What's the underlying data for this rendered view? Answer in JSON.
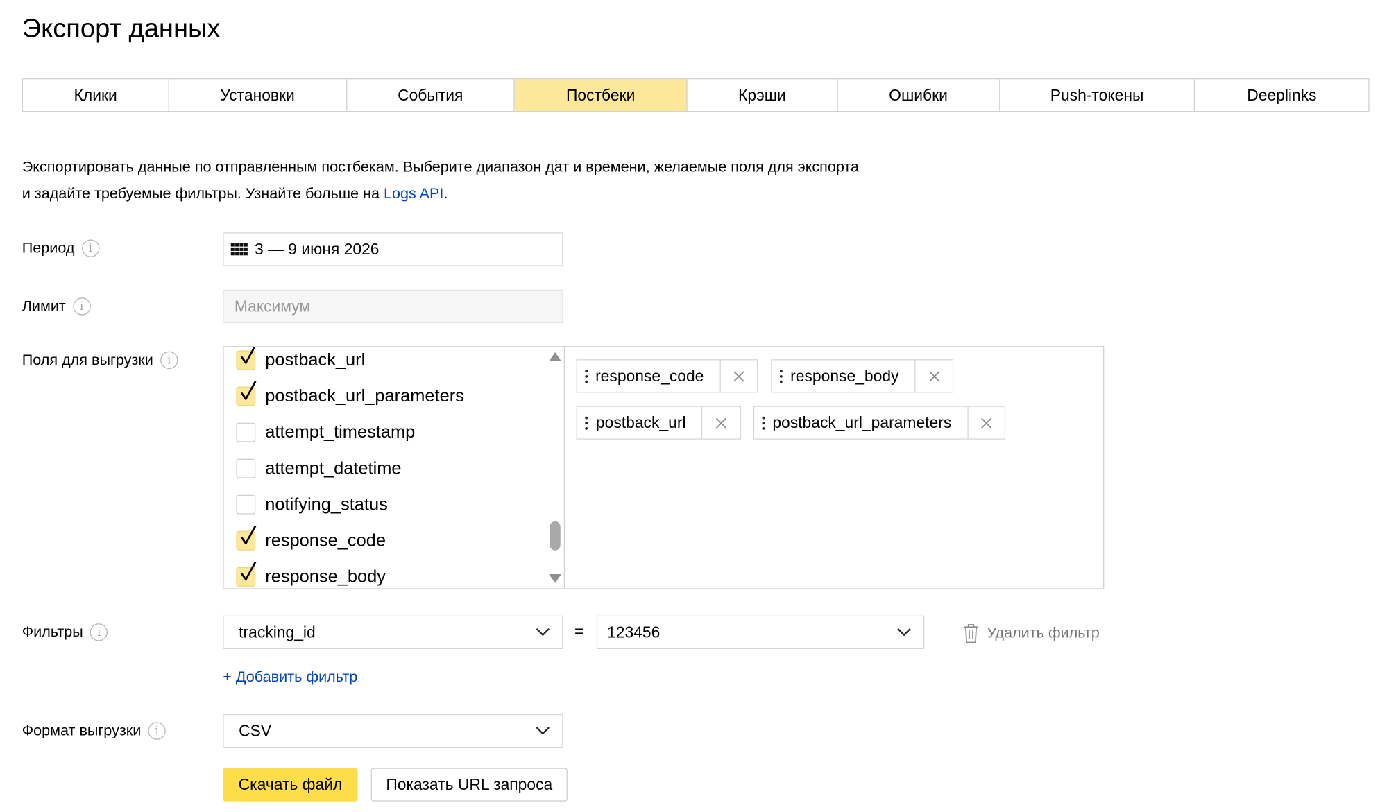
{
  "page_title": "Экспорт данных",
  "tabs": [
    {
      "label": "Клики",
      "active": false
    },
    {
      "label": "Установки",
      "active": false
    },
    {
      "label": "События",
      "active": false
    },
    {
      "label": "Постбеки",
      "active": true
    },
    {
      "label": "Крэши",
      "active": false
    },
    {
      "label": "Ошибки",
      "active": false
    },
    {
      "label": "Push-токены",
      "active": false
    },
    {
      "label": "Deeplinks",
      "active": false
    }
  ],
  "description": {
    "text": "Экспортировать данные по отправленным постбекам. Выберите диапазон дат и времени, желаемые поля для экспорта и задайте требуемые фильтры. Узнайте больше на ",
    "link_label": "Logs API",
    "suffix": "."
  },
  "period": {
    "label": "Период",
    "value": "3 — 9 июня 2026",
    "icon": "calendar-icon"
  },
  "limit": {
    "label": "Лимит",
    "placeholder": "Максимум",
    "value": ""
  },
  "fields": {
    "label": "Поля для выгрузки",
    "list": [
      {
        "name": "postback_url",
        "checked": true
      },
      {
        "name": "postback_url_parameters",
        "checked": true
      },
      {
        "name": "attempt_timestamp",
        "checked": false
      },
      {
        "name": "attempt_datetime",
        "checked": false
      },
      {
        "name": "notifying_status",
        "checked": false
      },
      {
        "name": "response_code",
        "checked": true
      },
      {
        "name": "response_body",
        "checked": true
      }
    ],
    "selected": [
      "response_code",
      "response_body",
      "postback_url",
      "postback_url_parameters"
    ]
  },
  "filters": {
    "label": "Фильтры",
    "field": "tracking_id",
    "operator": "=",
    "value": "123456",
    "delete_label": "Удалить фильтр",
    "add_label": "+ Добавить фильтр"
  },
  "format": {
    "label": "Формат выгрузки",
    "value": "CSV"
  },
  "actions": {
    "download": "Скачать файл",
    "show_url": "Показать URL запроса"
  },
  "colors": {
    "accent": "#fedd4a",
    "active_tab": "#fde79b",
    "link": "#0044bb"
  }
}
